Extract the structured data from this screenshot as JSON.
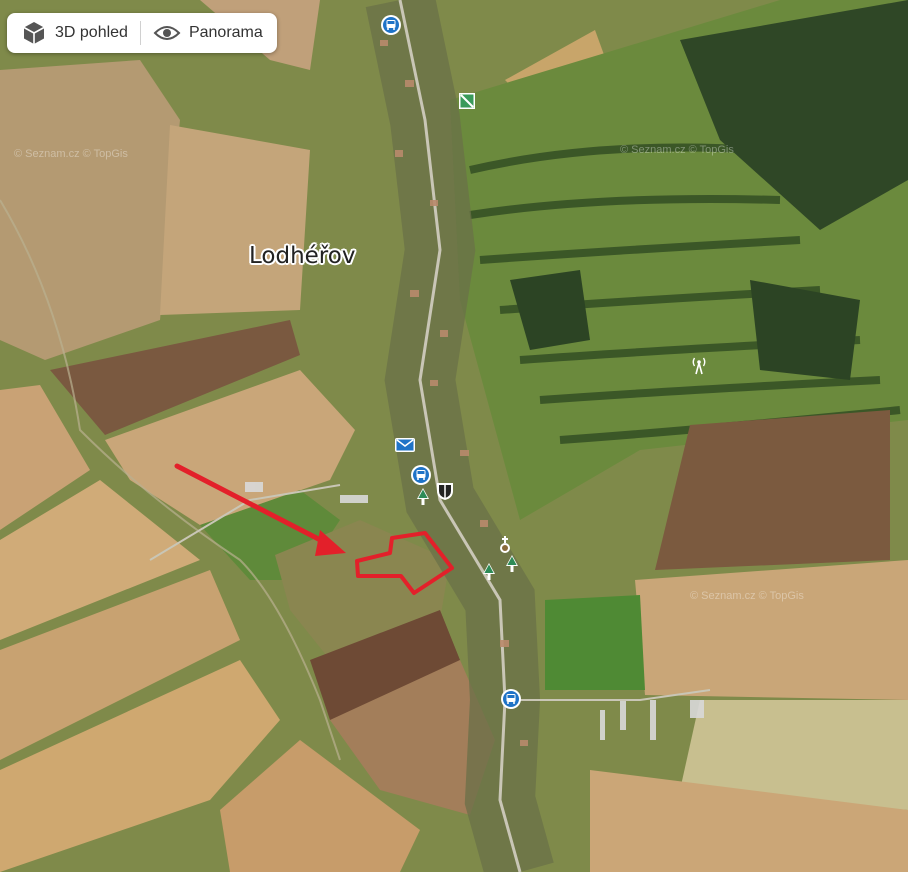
{
  "toolbar": {
    "btn_3d_label": "3D pohled",
    "btn_panorama_label": "Panorama"
  },
  "map": {
    "place_name": "Lodhéřov",
    "watermark_1": "© Seznam.cz  © TopGis",
    "watermark_2": "© Seznam.cz  © TopGis",
    "watermark_3": "© Seznam.cz  © TopGis",
    "highlight_color": "#e3202a",
    "poi_icons": [
      "bus-stop-icon",
      "bus-stop-icon",
      "bus-stop-icon",
      "post-office-icon",
      "tree-icon",
      "tree-icon",
      "tree-icon",
      "coat-of-arms-icon",
      "church-icon",
      "transmitter-icon",
      "map-sign-icon"
    ]
  }
}
